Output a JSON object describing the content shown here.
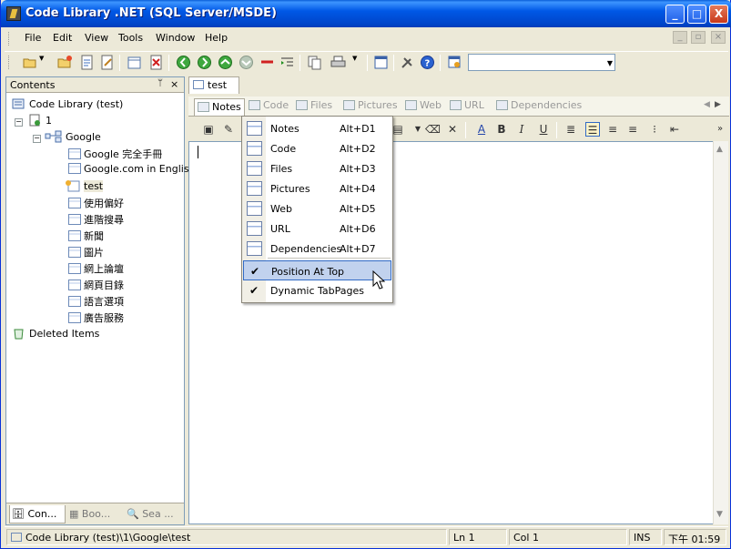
{
  "window": {
    "title": "Code Library .NET (SQL Server/MSDE)",
    "min_glyph": "_",
    "max_glyph": "□",
    "close_glyph": "X"
  },
  "menu": {
    "items": [
      "File",
      "Edit",
      "View",
      "Tools",
      "Window",
      "Help"
    ],
    "mdi_min": "_",
    "mdi_restore": "▫",
    "mdi_close": "×"
  },
  "toolbar": {
    "search_value": ""
  },
  "contents": {
    "title": "Contents",
    "pin_glyph": "📌",
    "close_glyph": "×",
    "tree": {
      "root": "Code Library (test)",
      "node1": "1",
      "google": "Google",
      "children": [
        "Google 完全手冊",
        "Google.com in English",
        "test",
        "使用偏好",
        "進階搜尋",
        "新聞",
        "圖片",
        "網上論壇",
        "網頁目錄",
        "語言選項",
        "廣告服務"
      ],
      "deleted": "Deleted Items"
    },
    "bottom_tabs": [
      "Con...",
      "Boo...",
      "Sea ..."
    ]
  },
  "document": {
    "tab": "test",
    "section_tabs": [
      "Notes",
      "Code",
      "Files",
      "Pictures",
      "Web",
      "URL",
      "Dependencies"
    ]
  },
  "popup": {
    "items": [
      {
        "label": "Notes",
        "shortcut": "Alt+D1"
      },
      {
        "label": "Code",
        "shortcut": "Alt+D2"
      },
      {
        "label": "Files",
        "shortcut": "Alt+D3"
      },
      {
        "label": "Pictures",
        "shortcut": "Alt+D4"
      },
      {
        "label": "Web",
        "shortcut": "Alt+D5"
      },
      {
        "label": "URL",
        "shortcut": "Alt+D6"
      },
      {
        "label": "Dependencies",
        "shortcut": "Alt+D7"
      }
    ],
    "options": [
      {
        "label": "Position At Top",
        "checked": true
      },
      {
        "label": "Dynamic TabPages",
        "checked": true
      }
    ]
  },
  "status": {
    "path": "Code Library (test)\\1\\Google\\test",
    "line": "Ln 1",
    "col": "Col 1",
    "mode": "INS",
    "time": "下午 01:59"
  },
  "colors": {
    "titlebar": "#0058E6",
    "highlight": "#C1D2EE",
    "highlight_border": "#316AC5"
  }
}
